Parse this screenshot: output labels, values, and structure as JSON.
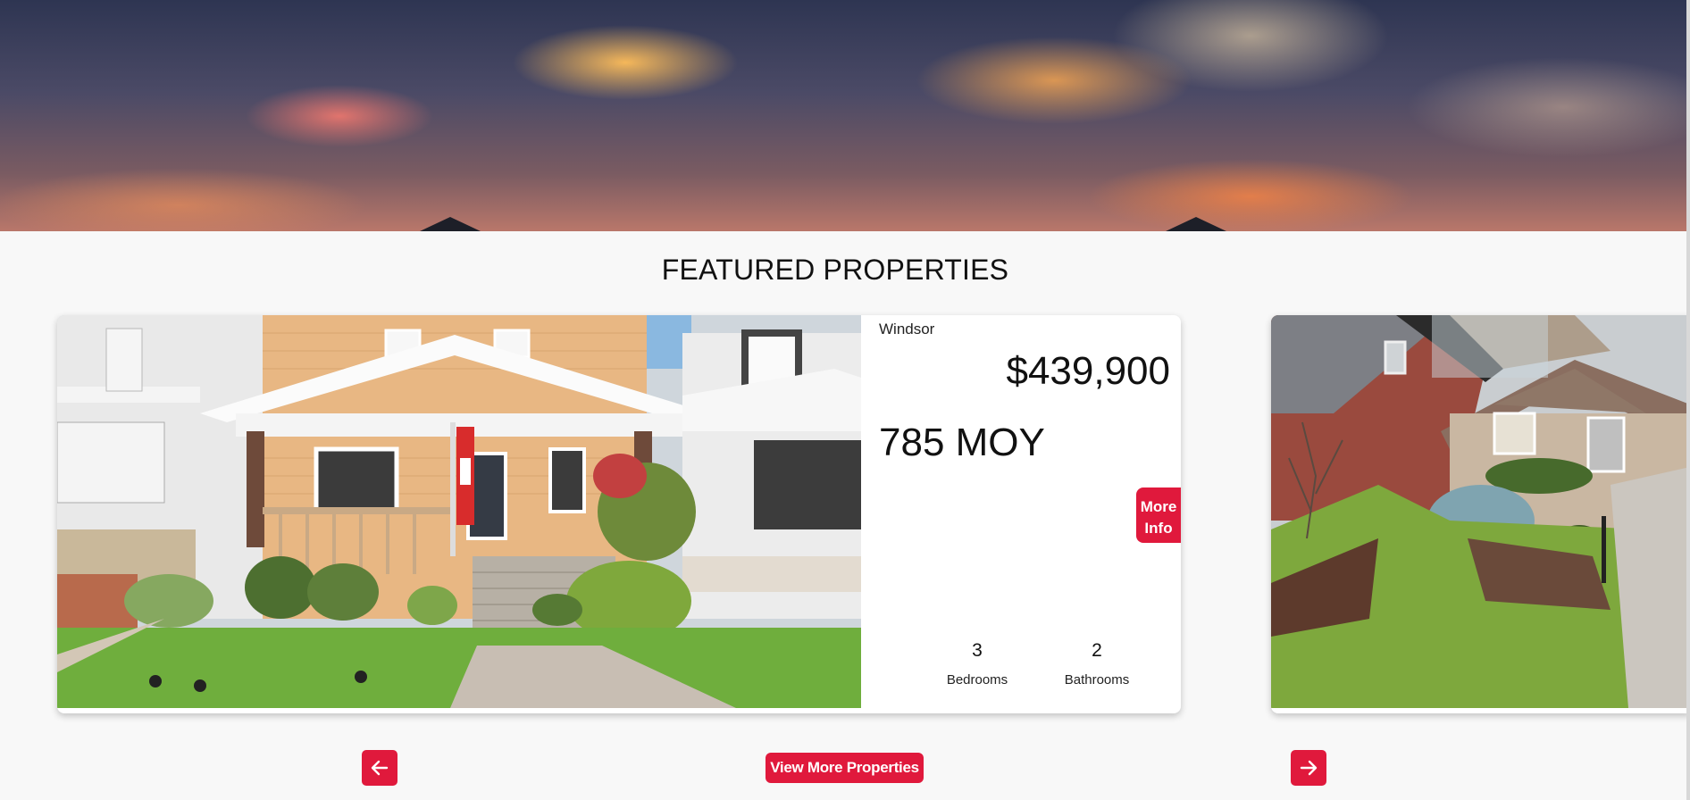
{
  "section": {
    "title": "FEATURED PROPERTIES"
  },
  "featured": {
    "city": "Windsor",
    "price": "$439,900",
    "address": "785 MOY",
    "more_info_label": "More Info",
    "bedrooms": {
      "value": "3",
      "label": "Bedrooms"
    },
    "bathrooms": {
      "value": "2",
      "label": "Bathrooms"
    }
  },
  "controls": {
    "view_more_label": "View More Properties",
    "prev_icon": "arrow-left-icon",
    "next_icon": "arrow-right-icon"
  },
  "colors": {
    "accent": "#e0193c",
    "background": "#f8f8f8",
    "card": "#ffffff"
  }
}
